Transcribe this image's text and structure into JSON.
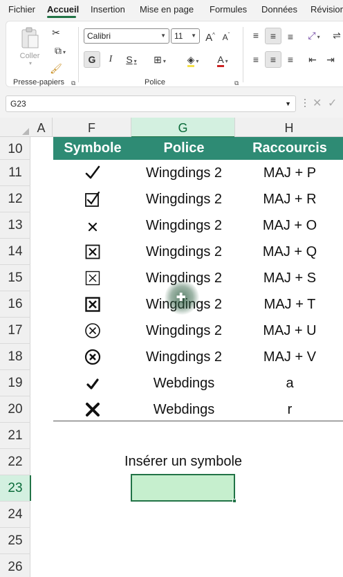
{
  "ribbon_tabs": [
    "Fichier",
    "Accueil",
    "Insertion",
    "Mise en page",
    "Formules",
    "Données",
    "Révision"
  ],
  "active_tab": "Accueil",
  "clipboard": {
    "paste_label": "Coller",
    "group_label": "Presse-papiers"
  },
  "font": {
    "name": "Calibri",
    "size": "11",
    "group_label": "Police",
    "bold": "G",
    "italic": "I",
    "underline": "S",
    "grow": "A",
    "shrink": "A",
    "color": "A"
  },
  "name_box": "G23",
  "columns": [
    "A",
    "F",
    "G",
    "H"
  ],
  "selected_column": "G",
  "rows": [
    "10",
    "11",
    "12",
    "13",
    "14",
    "15",
    "16",
    "17",
    "18",
    "19",
    "20",
    "21",
    "22",
    "23",
    "24",
    "25",
    "26"
  ],
  "selected_row": "23",
  "table": {
    "headers": {
      "symbol": "Symbole",
      "font": "Police",
      "shortcut": "Raccourcis"
    },
    "rows": [
      {
        "symbol_icon": "check-icon",
        "font": "Wingdings 2",
        "shortcut": "MAJ + P"
      },
      {
        "symbol_icon": "checked-box-icon",
        "font": "Wingdings 2",
        "shortcut": "MAJ + R"
      },
      {
        "symbol_icon": "small-x-icon",
        "font": "Wingdings 2",
        "shortcut": "MAJ + O"
      },
      {
        "symbol_icon": "x-box-icon",
        "font": "Wingdings 2",
        "shortcut": "MAJ + Q"
      },
      {
        "symbol_icon": "x-box-thin-icon",
        "font": "Wingdings 2",
        "shortcut": "MAJ + S"
      },
      {
        "symbol_icon": "x-box-bold-icon",
        "font": "Wingdings 2",
        "shortcut": "MAJ + T"
      },
      {
        "symbol_icon": "circled-x-icon",
        "font": "Wingdings 2",
        "shortcut": "MAJ + U"
      },
      {
        "symbol_icon": "circled-x-bold-icon",
        "font": "Wingdings 2",
        "shortcut": "MAJ + V"
      },
      {
        "symbol_icon": "bold-check-icon",
        "font": "Webdings",
        "shortcut": "a"
      },
      {
        "symbol_icon": "bold-x-icon",
        "font": "Webdings",
        "shortcut": "r"
      }
    ]
  },
  "insert_label": "Insérer un symbole",
  "colors": {
    "accent": "#217346",
    "table_header": "#2e8b74",
    "selected_cell": "#c6efce"
  }
}
